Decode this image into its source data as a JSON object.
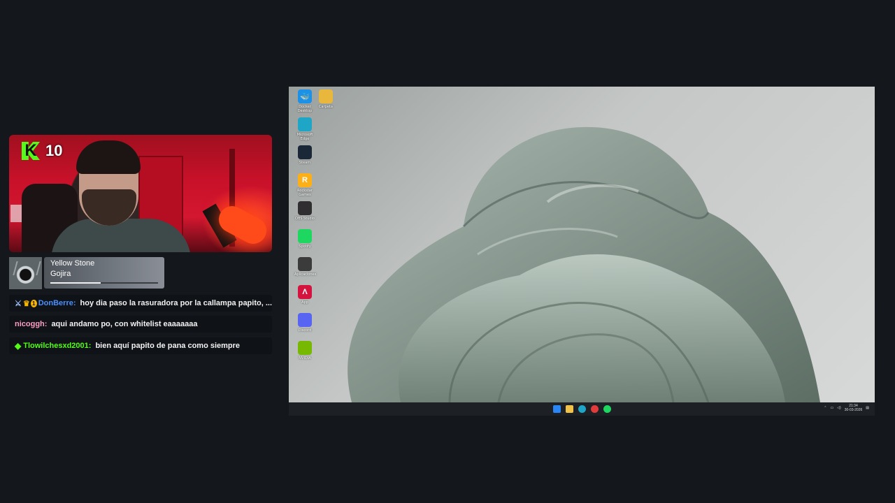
{
  "stream": {
    "platform_logo": "K",
    "viewer_count": "10"
  },
  "now_playing": {
    "title": "Yellow Stone",
    "artist": "Gojira",
    "progress": 0.47
  },
  "chat": [
    {
      "badges": [
        "sword-icon",
        "crown-icon",
        "number-1-badge"
      ],
      "badge_number": "1",
      "user": "DonBerre:",
      "user_color": "#4a8fff",
      "message": "hoy dia paso la rasuradora por la callampa papito, ..."
    },
    {
      "badges": [],
      "user": "nicoggh:",
      "user_color": "#ff9ec4",
      "message": "aqui andamo po, con whitelist eaaaaaaa"
    },
    {
      "badges": [
        "gem-icon"
      ],
      "user": "Tlowilchesxd2001:",
      "user_color": "#53fc18",
      "message": "bien aquí papito de pana como siempre"
    }
  ],
  "desktop": {
    "icons": [
      {
        "name": "docker-desktop-icon",
        "label": "Docker Desktop",
        "color": "#1d91e6",
        "glyph": "🐳"
      },
      {
        "name": "folder-icon",
        "label": "Carpeta",
        "color": "#e8b73c",
        "glyph": ""
      },
      {
        "name": "edge-icon",
        "label": "Microsoft Edge",
        "color": "#1fa5c6",
        "glyph": ""
      },
      {
        "name": "steam-icon",
        "label": "Steam",
        "color": "#1b2838",
        "glyph": ""
      },
      {
        "name": "rockstar-icon",
        "label": "Rockstar Games",
        "color": "#fcaf17",
        "glyph": "R"
      },
      {
        "name": "obs-icon",
        "label": "OBS Studio",
        "color": "#302e31",
        "glyph": ""
      },
      {
        "name": "spotify-icon",
        "label": "Spotify",
        "color": "#1ed760",
        "glyph": ""
      },
      {
        "name": "app-grid-icon",
        "label": "Aplicaciones",
        "color": "#3b3b3b",
        "glyph": ""
      },
      {
        "name": "app-red-icon",
        "label": "App",
        "color": "#d4143f",
        "glyph": "Λ"
      },
      {
        "name": "discord-icon",
        "label": "Discord",
        "color": "#5865f2",
        "glyph": ""
      },
      {
        "name": "nvidia-icon",
        "label": "NVIDIA",
        "color": "#76b900",
        "glyph": ""
      }
    ],
    "clock_time": "21:34",
    "clock_date": "30-03-2026"
  }
}
